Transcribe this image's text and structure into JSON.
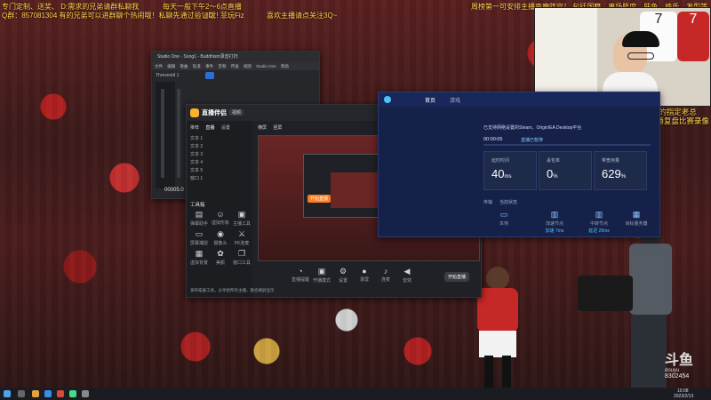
{
  "ticker": {
    "line1": "专门定制、送奖、 D:需求的兄弟请群私聊我",
    "line1b": "每天一般下午2～6点直播",
    "line1c": "喜欢主播请点关注3Q~",
    "line2": "Q群：857081304  有的兄弟可以进群聊个热闹哦！私聊先通过验证哦！",
    "line2b": "ID：菲玩Fiz",
    "top_right": "周榜第一可安排主播南磨阵容！ 包括国籍、离场胖度、肤色、姓氏、发型等",
    "promo1": "开通钻殿直接成为Fiz的指定老总",
    "promo2": "每月享受两场主播直播复盘比赛录像"
  },
  "watermark": {
    "brand": "斗鱼",
    "sub": "douyu",
    "room": "8302454"
  },
  "cam": {
    "jersey_left": "7",
    "jersey_right": "7"
  },
  "studio_one": {
    "title": "Studio One · Song1 - Buddhism录音打扫",
    "menu": [
      "文件",
      "编辑",
      "歌曲",
      "轨道",
      "事件",
      "音频",
      "传送",
      "视图",
      "Studio One",
      "帮助"
    ],
    "track": "Thresnold 1",
    "counter": "00005.0"
  },
  "obs_dark": {
    "logo": "直播伴侣",
    "sub_tab": "视频",
    "left_tabs": [
      "推荐",
      "直播",
      "设置"
    ],
    "left_items": [
      "文本 1",
      "文本 2",
      "文本 3",
      "文本 4",
      "文本 5",
      "窗口 1"
    ],
    "tools_header": "工具箱",
    "tools": [
      "弹幕助手",
      "虚拟形象",
      "主播工具",
      "屏幕捕捉",
      "摄像头",
      "PK连麦",
      "虚拟背景",
      "美颜",
      "窗口工具",
      "更多功能"
    ],
    "notice": "发布拓展工具，分享给所有主播，联合刷屏显示",
    "preview_tabs": [
      "横屏",
      "竖屏"
    ],
    "bottom_actions": [
      "直播提醒",
      "开播模式",
      "设置",
      "录屏",
      "连麦",
      "音效",
      "直播间",
      "场景"
    ],
    "start_button": "开始直播",
    "overlay_badge": "开始直播"
  },
  "blue_panel": {
    "tabs": [
      "首页",
      "游戏"
    ],
    "notice": "已支持网络设置的Steam、Origin/EA Desktop平台",
    "timer": "00:00:05",
    "status": "直播已暂停",
    "stats": [
      {
        "title": "延时时间",
        "value": "40",
        "unit": "ms"
      },
      {
        "title": "丢包率",
        "value": "0",
        "unit": "%"
      },
      {
        "title": "带宽用量",
        "value": "629",
        "unit": "%"
      }
    ],
    "section": "传输",
    "section2": "当前状态",
    "nodes": [
      {
        "label": "本地",
        "sub": ""
      },
      {
        "label": "加速节点",
        "sub": "加速 7ms"
      },
      {
        "label": "中转节点",
        "sub": "延迟 29ms"
      },
      {
        "label": "目标服务器",
        "sub": ""
      }
    ]
  },
  "taskbar": {
    "time": "10:08",
    "date": "2023/2/13"
  },
  "colors": {
    "accent_blue": "#1c2a55",
    "ticker_yellow": "#ffd54a",
    "douyu_orange": "#ff7a1a"
  }
}
